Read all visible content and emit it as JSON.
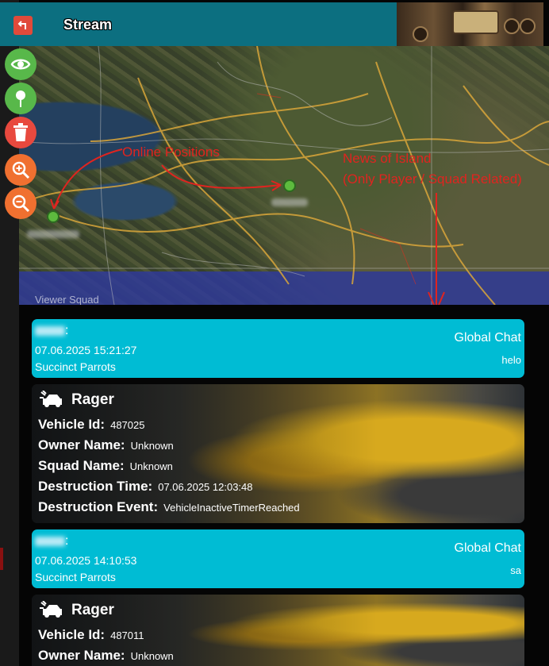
{
  "header": {
    "title": "Stream"
  },
  "map": {
    "annotation_positions": "Online Positions",
    "annotation_news_line1": "News of Island",
    "annotation_news_line2": "(Only Player / Squad Related)",
    "partial_text": "Viewer Squad"
  },
  "side_buttons": [
    {
      "icon": "eye-icon",
      "color": "#58b84a"
    },
    {
      "icon": "map-pin-icon",
      "color": "#58b84a"
    },
    {
      "icon": "trash-icon",
      "color": "#e8493e"
    },
    {
      "icon": "zoom-in-icon",
      "color": "#f07030"
    },
    {
      "icon": "zoom-out-icon",
      "color": "#f07030"
    }
  ],
  "feed": [
    {
      "type": "chat",
      "suffix": ":",
      "time": "07.06.2025 15:21:27",
      "squad": "Succinct Parrots",
      "channel": "Global Chat",
      "message": "helo"
    },
    {
      "type": "vehicle",
      "title": "Rager",
      "rows": [
        {
          "label": "Vehicle Id:",
          "value": "487025"
        },
        {
          "label": "Owner Name:",
          "value": "Unknown"
        },
        {
          "label": "Squad Name:",
          "value": "Unknown"
        },
        {
          "label": "Destruction Time:",
          "value": "07.06.2025 12:03:48"
        },
        {
          "label": "Destruction Event:",
          "value": "VehicleInactiveTimerReached"
        }
      ]
    },
    {
      "type": "chat",
      "suffix": ":",
      "time": "07.06.2025 14:10:53",
      "squad": "Succinct Parrots",
      "channel": "Global Chat",
      "message": "sa"
    },
    {
      "type": "vehicle",
      "title": "Rager",
      "rows": [
        {
          "label": "Vehicle Id:",
          "value": "487011"
        },
        {
          "label": "Owner Name:",
          "value": "Unknown"
        }
      ]
    }
  ],
  "colors": {
    "header": "#0c6f80",
    "chat_card": "#00bcd4",
    "annotation": "#e0241f",
    "marker": "#5dbb3e"
  }
}
